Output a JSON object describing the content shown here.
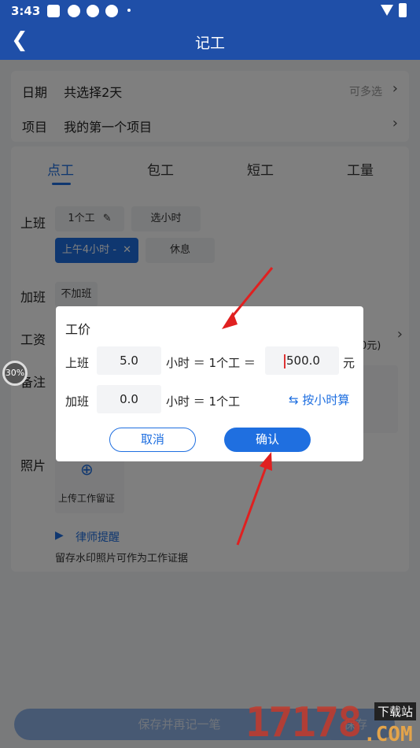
{
  "status_bar": {
    "time": "3:43"
  },
  "nav": {
    "title": "记工"
  },
  "form": {
    "date_label": "日期",
    "date_value": "共选择2天",
    "date_hint": "可多选",
    "project_label": "项目",
    "project_value": "我的第一个项目"
  },
  "tabs": [
    "点工",
    "包工",
    "短工",
    "工量"
  ],
  "work": {
    "shift_label": "上班",
    "shift_chip": "1个工",
    "select_hours_chip": "选小时",
    "morning_chip": "上午4小时 -",
    "rest_chip": "休息",
    "overtime_label": "加班",
    "overtime_chip": "不加班",
    "wage_label": "工资",
    "wage_tail": "0元)",
    "note_label": "备注",
    "photo_label": "照片",
    "upload_label": "上传工作留证",
    "lawyer_tip": "律师提醒",
    "tip_text": "留存水印照片可作为工作证据"
  },
  "progress_label": "30%",
  "bottom": {
    "save_again": "保存并再记一笔",
    "save": "保存"
  },
  "watermark": {
    "number": "17178",
    "site": "下载站",
    "domain": ".COM"
  },
  "dialog": {
    "title": "工价",
    "row1_label": "上班",
    "row1_hours": "5.0",
    "row1_unit": "小时 ＝ 1个工 ＝",
    "row1_amount": "500.0",
    "row1_currency": "元",
    "row2_label": "加班",
    "row2_hours": "0.0",
    "row2_unit": "小时 ＝ 1个工",
    "toggle_label": "按小时算",
    "cancel": "取消",
    "confirm": "确认"
  },
  "colors": {
    "primary": "#1f6fe0",
    "navbar": "#1f4fa8",
    "annotation_arrow": "#e02020"
  }
}
